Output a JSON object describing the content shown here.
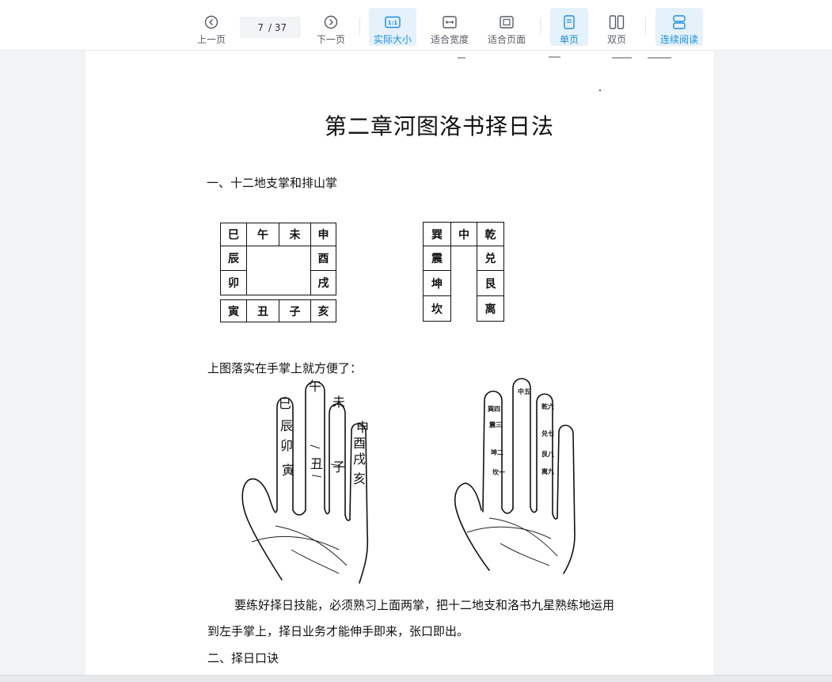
{
  "toolbar": {
    "prev_label": "上一页",
    "next_label": "下一页",
    "page_current": "7",
    "page_total": "/ 37",
    "actual_size_label": "实际大小",
    "fit_width_label": "适合宽度",
    "fit_page_label": "适合页面",
    "single_page_label": "单页",
    "double_page_label": "双页",
    "continuous_label": "连续阅读",
    "accent_color": "#1a8fe3"
  },
  "doc": {
    "title": "第二章河图洛书择日法",
    "section1": "一、十二地支掌和排山掌",
    "branch_grid": {
      "top": [
        "巳",
        "午",
        "未",
        "申"
      ],
      "left": [
        "辰",
        "卯"
      ],
      "right": [
        "酉",
        "戌"
      ],
      "bottom": [
        "寅",
        "丑",
        "子",
        "亥"
      ]
    },
    "trigram_grid": {
      "top": [
        "巽",
        "中",
        "乾"
      ],
      "left": [
        "震",
        "坤",
        "坎"
      ],
      "right": [
        "兑",
        "艮",
        "离"
      ]
    },
    "hand_caption": "上图落实在手掌上就方便了：",
    "left_hand": {
      "si": "巳",
      "chen": "辰",
      "mao": "卯",
      "yin": "寅",
      "wu": "午",
      "chou": "丑",
      "wei": "未",
      "zi": "子",
      "shen": "申",
      "you": "酉",
      "xu": "戌",
      "hai": "亥"
    },
    "right_hand": {
      "xun4": "巽四",
      "zhen3": "震三",
      "kun2": "坤二",
      "kan1": "坎一",
      "zhong5": "中五",
      "qian6": "乾六",
      "dui7": "兑七",
      "gen8": "艮八",
      "li9": "离九"
    },
    "para_line1": "要练好择日技能，必须熟习上面两掌，把十二地支和洛书九星熟练地运用",
    "para_line2": "到左手掌上，择日业务才能伸手即来，张口即出。",
    "section2": "二、择日口诀"
  }
}
